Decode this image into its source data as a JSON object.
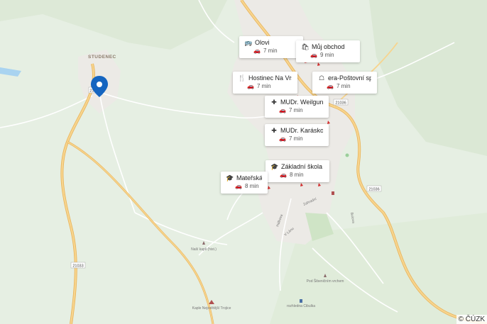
{
  "places": [
    {
      "name": "Olovi",
      "time": "7 min",
      "icon": "bus-icon"
    },
    {
      "name": "Můj obchod",
      "time": "9 min",
      "icon": "shop-icon"
    },
    {
      "name": "Hostinec Na Vršku",
      "time": "7 min",
      "icon": "restaurant-icon"
    },
    {
      "name": "era-Poštovní spoř...",
      "time": "7 min",
      "icon": "bank-icon"
    },
    {
      "name": "MUDr. Weilguny Iva",
      "time": "7 min",
      "icon": "medical-icon"
    },
    {
      "name": "MUDr. Karásková ...",
      "time": "7 min",
      "icon": "medical-icon"
    },
    {
      "name": "Základní škola Ol...",
      "time": "8 min",
      "icon": "school-icon"
    },
    {
      "name": "Mateřská škola",
      "time": "8 min",
      "icon": "school-icon"
    }
  ],
  "map_labels": {
    "town": "STUDENEC",
    "road_1": "21036",
    "road_2": "21036",
    "road_3": "21033",
    "road_4": "21036",
    "poi_1": "Naší kapli (hist.)",
    "poi_2": "Kaple Nejsvětější Trojice",
    "poi_3": "Pod Šibeničním vrchem",
    "poi_4": "rozhledna Cibulka",
    "street_1": "Zahradní",
    "street_2": "Hálkova",
    "street_3": "V Lánu",
    "street_4": "Bulova"
  },
  "copyright": "© ČÚZK",
  "colors": {
    "pin": "#1565c0",
    "road": "#f5c97a",
    "water": "#a9d3f0"
  }
}
